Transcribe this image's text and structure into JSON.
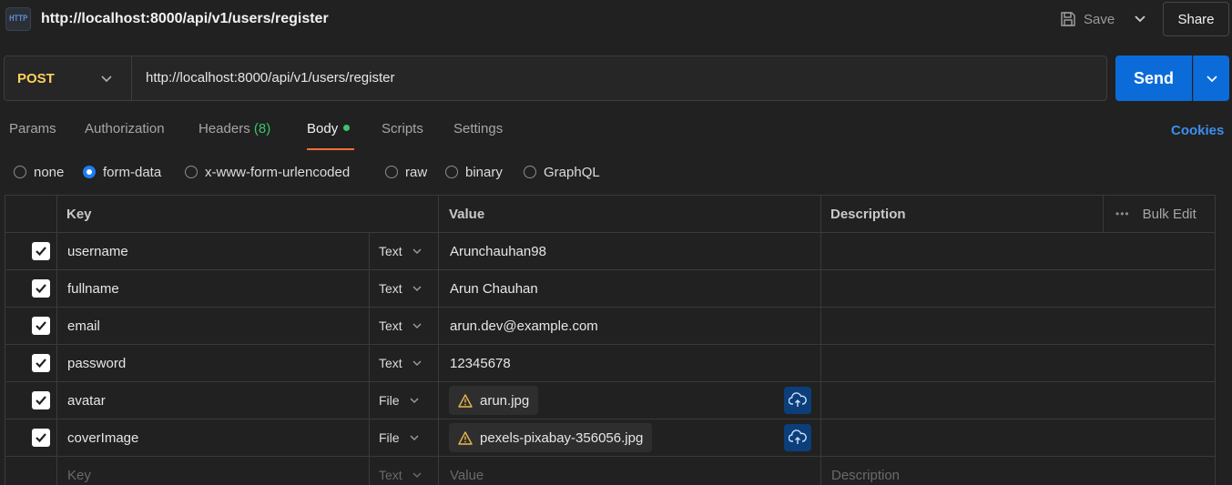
{
  "header": {
    "icon_text": "HTTP",
    "title": "http://localhost:8000/api/v1/users/register",
    "save_label": "Save",
    "share_label": "Share"
  },
  "url_bar": {
    "method": "POST",
    "url": "http://localhost:8000/api/v1/users/register",
    "send_label": "Send"
  },
  "tabs": {
    "params": "Params",
    "authorization": "Authorization",
    "headers": "Headers",
    "headers_count": "(8)",
    "body": "Body",
    "scripts": "Scripts",
    "settings": "Settings",
    "cookies": "Cookies",
    "active": "Body"
  },
  "body_types": {
    "none": "none",
    "form_data": "form-data",
    "urlencoded": "x-www-form-urlencoded",
    "raw": "raw",
    "binary": "binary",
    "graphql": "GraphQL",
    "selected": "form-data"
  },
  "table": {
    "headers": {
      "key": "Key",
      "value": "Value",
      "description": "Description",
      "bulk_edit": "Bulk Edit"
    },
    "rows": [
      {
        "key": "username",
        "type": "Text",
        "value": "Arunchauhan98",
        "checked": true
      },
      {
        "key": "fullname",
        "type": "Text",
        "value": "Arun Chauhan",
        "checked": true
      },
      {
        "key": "email",
        "type": "Text",
        "value": "arun.dev@example.com",
        "checked": true
      },
      {
        "key": "password",
        "type": "Text",
        "value": "12345678",
        "checked": true
      },
      {
        "key": "avatar",
        "type": "File",
        "value": "arun.jpg",
        "checked": true
      },
      {
        "key": "coverImage",
        "type": "File",
        "value": "pexels-pixabay-356056.jpg",
        "checked": true
      }
    ],
    "placeholder_row": {
      "key": "Key",
      "type": "Text",
      "value": "Value",
      "description": "Description"
    }
  },
  "colors": {
    "method": "#ffd15e",
    "send": "#0b6bd8",
    "active_tab": "#ff6c37",
    "cookies": "#3b8ef0",
    "count": "#3cc46a"
  }
}
